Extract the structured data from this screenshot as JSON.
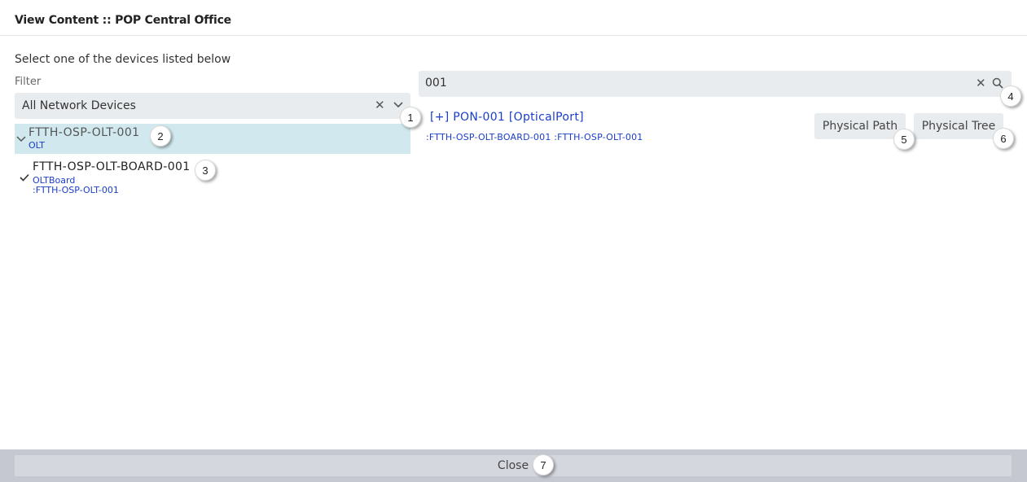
{
  "header": {
    "title": "View Content :: POP Central Office"
  },
  "instruction": "Select one of the devices listed below",
  "filter": {
    "label": "Filter",
    "selected": "All Network Devices",
    "clear_icon": "✕"
  },
  "tree": [
    {
      "name": "FTTH-OSP-OLT-001",
      "type": "OLT",
      "expanded": true,
      "selected_row": true
    },
    {
      "name": "FTTH-OSP-OLT-BOARD-001",
      "type": "OLTBoard",
      "parent": ":FTTH-OSP-OLT-001",
      "checked": true
    }
  ],
  "search": {
    "value": "001",
    "clear_icon": "✕"
  },
  "result": {
    "title": "[+] PON-001 [OpticalPort]",
    "path": ":FTTH-OSP-OLT-BOARD-001 :FTTH-OSP-OLT-001"
  },
  "buttons": {
    "physical_path": "Physical Path",
    "physical_tree": "Physical Tree",
    "close": "Close"
  },
  "badges": [
    "1",
    "2",
    "3",
    "4",
    "5",
    "6",
    "7"
  ],
  "colors": {
    "selected_row_bg": "#d1e9ee",
    "link_blue": "#1a3ec8",
    "input_bg": "#e9ecef",
    "footer_bg": "#c6c8d1"
  }
}
